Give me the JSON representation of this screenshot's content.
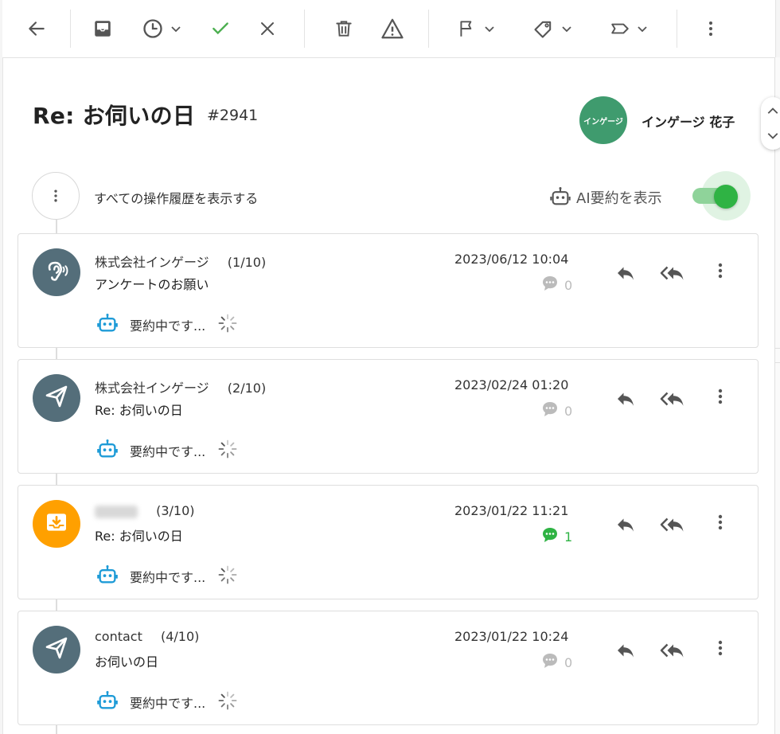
{
  "toolbar": {
    "icons": [
      "back-arrow-icon",
      "archive-icon",
      "clock-icon",
      "check-icon",
      "close-icon",
      "trash-icon",
      "warning-icon",
      "flag-icon",
      "tag-icon",
      "label-icon",
      "more-vertical-icon"
    ],
    "check_color": "#4caf50"
  },
  "header": {
    "subject": "Re: お伺いの日",
    "ticket_id": "#2941",
    "assignee_avatar_text": "インゲージ",
    "assignee_name": "インゲージ 花子",
    "assignee_color": "#3f9b6e"
  },
  "history": {
    "label": "すべての操作履歴を表示する"
  },
  "ai_summary_toggle": {
    "label": "AI要約を表示",
    "enabled": true,
    "color": "#2fb344"
  },
  "messages": [
    {
      "sender": "株式会社インゲージ",
      "position": "(1/10)",
      "subject": "アンケートのお願い",
      "date": "2023/06/12 10:04",
      "comment_count": "0",
      "avatar_icon": "ear-icon",
      "avatar_color": "#546e7a",
      "summary_status": "要約中です..."
    },
    {
      "sender": "株式会社インゲージ",
      "position": "(2/10)",
      "subject": "Re: お伺いの日",
      "date": "2023/02/24 01:20",
      "comment_count": "0",
      "avatar_icon": "send-icon",
      "avatar_color": "#546e7a",
      "summary_status": "要約中です..."
    },
    {
      "sender": "",
      "position": "(3/10)",
      "subject": "Re: お伺いの日",
      "date": "2023/01/22 11:21",
      "comment_count": "1",
      "avatar_icon": "inbox-icon",
      "avatar_color": "#ffa000",
      "summary_status": "要約中です..."
    },
    {
      "sender": "contact",
      "position": "(4/10)",
      "subject": "お伺いの日",
      "date": "2023/01/22 10:24",
      "comment_count": "0",
      "avatar_icon": "send-icon",
      "avatar_color": "#546e7a",
      "summary_status": "要約中です..."
    }
  ],
  "colors": {
    "comment_active": "#2fb344",
    "comment_inactive": "#bbbbbb",
    "robot": "#1e9bd7"
  }
}
